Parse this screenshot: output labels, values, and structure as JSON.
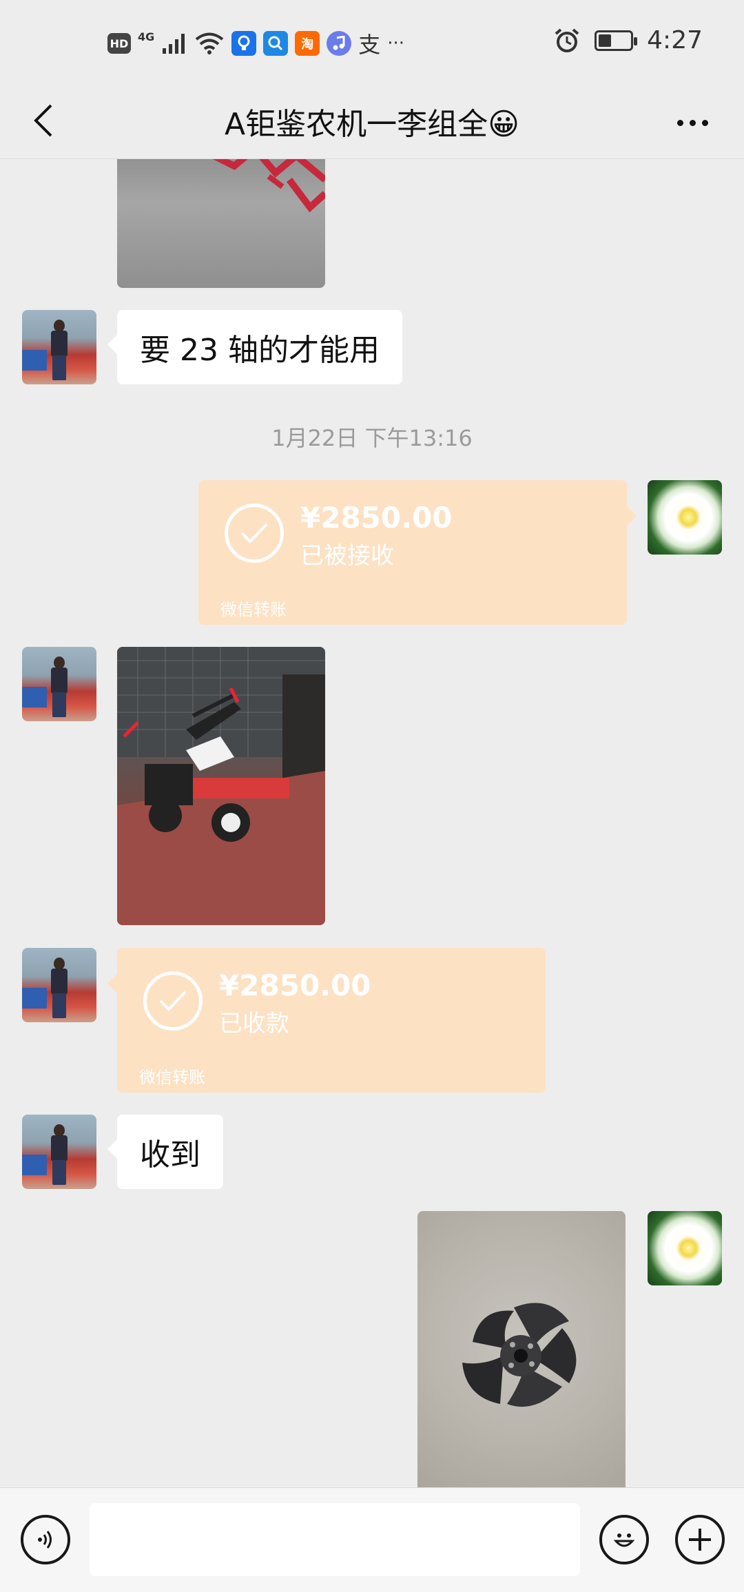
{
  "status_bar": {
    "left_icons": [
      "hd-icon",
      "4g-signal-icon",
      "wifi-icon",
      "bulb-app-icon",
      "search-app-icon",
      "taobao-app-icon",
      "music-app-icon",
      "alipay-app-icon",
      "more-dots-icon"
    ],
    "hd_label": "HD",
    "net_label": "4G",
    "taobao_label": "淘",
    "alipay_label": "支",
    "more_label": "···",
    "time": "4:27",
    "battery_level": 0.36
  },
  "header": {
    "title": "A钜鉴农机一李组全😀"
  },
  "messages": {
    "text_1": "要 23 轴的才能用",
    "timestamp_1": "1月22日 下午13:16",
    "transfer_sent": {
      "amount": "¥2850.00",
      "status": "已被接收",
      "label": "微信转账"
    },
    "transfer_received": {
      "amount": "¥2850.00",
      "status": "已收款",
      "label": "微信转账"
    },
    "text_2": "收到"
  },
  "colors": {
    "background": "#ededed",
    "bubble": "#ffffff",
    "transfer_bg": "#fde1c3"
  }
}
